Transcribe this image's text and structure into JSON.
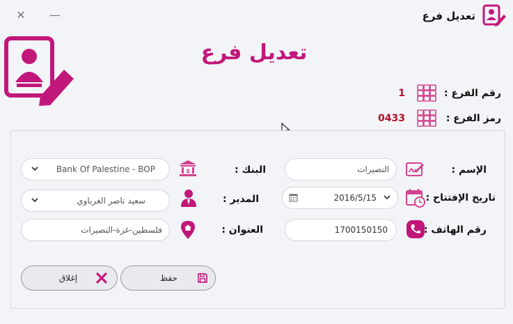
{
  "window": {
    "title": "تعديل فرع",
    "minimize": "—",
    "close": "✕"
  },
  "heading": "تعديل فرع",
  "branch_number": {
    "label": "رقم الفرع :",
    "value": "1"
  },
  "branch_code": {
    "label": "رمز الفرع :",
    "value": "0433"
  },
  "form": {
    "name": {
      "label": "الإسم :",
      "value": "النصيرات"
    },
    "opening_date": {
      "label": "تاريخ الإفتتاح :",
      "value": "2016/5/15"
    },
    "phone": {
      "label": "رقم الهاتف :",
      "value": "1700150150"
    },
    "bank": {
      "label": "البنك :",
      "value": "Bank Of Palestine - BOP"
    },
    "manager": {
      "label": "المدير :",
      "value": "سعيد ناصر الغرباوي"
    },
    "address": {
      "label": "العنوان :",
      "value": "فلسطين-غزة-النصيرات"
    }
  },
  "buttons": {
    "save": "حفظ",
    "close": "إغلاق"
  },
  "colors": {
    "accent": "#c2177a",
    "value_red": "#b0102a",
    "icon_pink": "#d4418e"
  }
}
